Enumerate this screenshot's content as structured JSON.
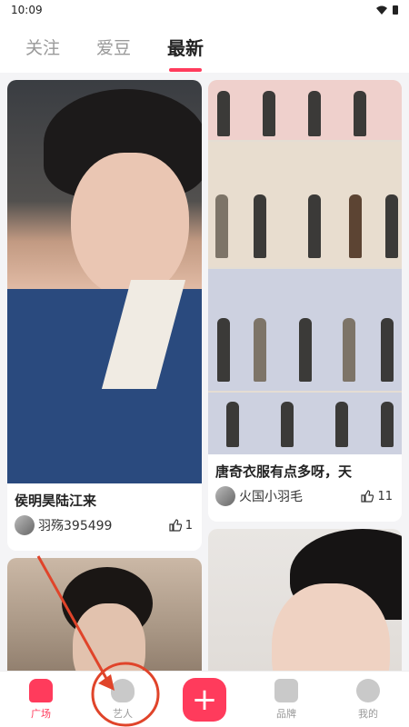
{
  "status_bar": {
    "time": "10:09"
  },
  "top_tabs": [
    {
      "label": "关注",
      "active": false
    },
    {
      "label": "爱豆",
      "active": false
    },
    {
      "label": "最新",
      "active": true
    }
  ],
  "feed": {
    "cards": [
      {
        "title": "侯明昊陆江来",
        "author": "羽殇395499",
        "likes": "1",
        "image": "portrait-icon"
      },
      {
        "title": "唐奇衣服有点多呀，天",
        "author": "火国小羽毛",
        "likes": "11",
        "image": "fashion-lineup-icon"
      },
      {
        "title": "",
        "author": "",
        "likes": "",
        "image": "portrait-icon"
      },
      {
        "title": "",
        "author": "",
        "likes": "",
        "image": "portrait-icon"
      }
    ]
  },
  "bottom_nav": {
    "items": [
      {
        "label": "广场",
        "icon": "home-icon",
        "active": true
      },
      {
        "label": "艺人",
        "icon": "planet-icon",
        "active": false
      },
      {
        "label": "+",
        "icon": "plus-icon",
        "active": false
      },
      {
        "label": "品牌",
        "icon": "brand-icon",
        "active": false
      },
      {
        "label": "我的",
        "icon": "profile-icon",
        "active": false
      }
    ]
  },
  "colors": {
    "accent": "#ff3b5c",
    "annotation": "#e0442a"
  }
}
